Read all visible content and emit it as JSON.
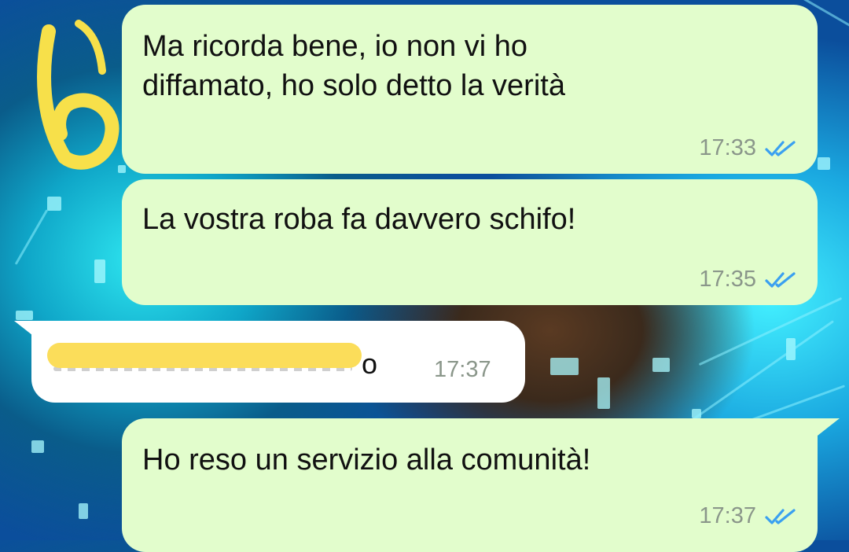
{
  "messages": [
    {
      "id": "m1",
      "direction": "outgoing",
      "lines": [
        "Ma ricorda bene, io non vi ho",
        "diffamato, ho solo detto la verità"
      ],
      "time": "17:33",
      "status": "read"
    },
    {
      "id": "m2",
      "direction": "outgoing",
      "lines": [
        "La vostra roba fa davvero schifo!"
      ],
      "time": "17:35",
      "status": "read"
    },
    {
      "id": "m3",
      "direction": "incoming",
      "visible_text": "o",
      "redacted": true,
      "time": "17:37"
    },
    {
      "id": "m4",
      "direction": "outgoing",
      "lines": [
        "Ho reso un servizio alla comunità!"
      ],
      "time": "17:37",
      "status": "read"
    }
  ],
  "annotation": {
    "label": "6",
    "color": "#f7e04a"
  },
  "colors": {
    "outgoing_bubble": "#e2fdcc",
    "incoming_bubble": "#ffffff",
    "read_ticks": "#3aa0f0",
    "redaction": "#fbdd5a"
  },
  "icons": {
    "read_receipt": "double-check-icon"
  }
}
